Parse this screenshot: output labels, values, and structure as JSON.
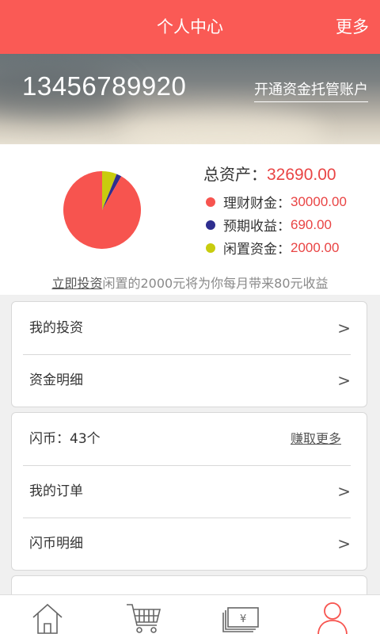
{
  "header": {
    "title": "个人中心",
    "more_label": "更多"
  },
  "banner": {
    "phone": "13456789920",
    "open_account_label": "开通资金托管账户"
  },
  "assets": {
    "total_label": "总资产：",
    "total_value": "32690.00",
    "items": [
      {
        "label": "理财财金：",
        "value": "30000.00",
        "color": "#f7544f"
      },
      {
        "label": "预期收益：",
        "value": "690.00",
        "color": "#2e2e8f"
      },
      {
        "label": "闲置资金：",
        "value": "2000.00",
        "color": "#c8cc0e"
      }
    ],
    "promo_link": "立即投资",
    "promo_text": "闲置的2000元将为你每月带来80元收益"
  },
  "chart_data": {
    "type": "pie",
    "categories": [
      "理财财金",
      "预期收益",
      "闲置资金"
    ],
    "values": [
      30000,
      690,
      2000
    ],
    "colors": [
      "#f7544f",
      "#2e2e8f",
      "#c8cc0e"
    ]
  },
  "menu1": {
    "items": [
      {
        "label": "我的投资"
      },
      {
        "label": "资金明细"
      }
    ]
  },
  "menu2": {
    "coins_label": "闪币：43个",
    "earn_more_label": "赚取更多",
    "items": [
      {
        "label": "我的订单"
      },
      {
        "label": "闪币明细"
      }
    ]
  },
  "tabbar": {
    "icons": [
      "home-icon",
      "cart-icon",
      "money-icon",
      "user-icon"
    ],
    "active_color": "#f7544f"
  }
}
